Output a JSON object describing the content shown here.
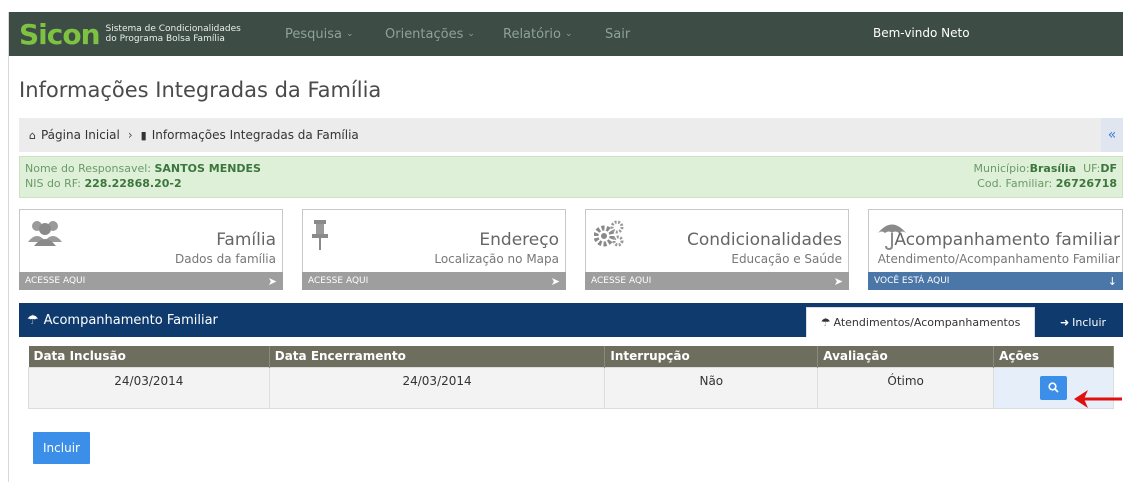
{
  "header": {
    "logo": "Sicon",
    "logo_line1": "Sistema de Condicionalidades",
    "logo_line2": "do Programa Bolsa Família",
    "nav": [
      "Pesquisa",
      "Orientações",
      "Relatório",
      "Sair"
    ],
    "welcome": "Bem-vindo Neto"
  },
  "page_title": "Informações Integradas da Família",
  "breadcrumb": {
    "home": "Página Inicial",
    "current": "Informações Integradas da Família",
    "collapse": "«"
  },
  "responsavel": {
    "nome_label": "Nome do Responsavel:",
    "nome": "SANTOS MENDES",
    "nis_label": "NIS do RF:",
    "nis": "228.22868.20-2",
    "municipio_label": "Município:",
    "municipio": "Brasília",
    "uf_label": "UF:",
    "uf": "DF",
    "cod_label": "Cod. Familiar:",
    "cod": "26726718"
  },
  "cards": [
    {
      "title": "Família",
      "subtitle": "Dados da família",
      "footer": "ACESSE AQUI",
      "icon": "users-icon"
    },
    {
      "title": "Endereço",
      "subtitle": "Localização no Mapa",
      "footer": "ACESSE AQUI",
      "icon": "pin-icon"
    },
    {
      "title": "Condicionalidades",
      "subtitle": "Educação e Saúde",
      "footer": "ACESSE AQUI",
      "icon": "gears-icon"
    },
    {
      "title": "Acompanhamento familiar",
      "subtitle": "Atendimento/Acompanhamento Familiar",
      "footer": "VOCÊ ESTÁ AQUI",
      "icon": "umbrella-icon"
    }
  ],
  "panel": {
    "title": "Acompanhamento Familiar",
    "tab_active": "Atendimentos/Acompanhamentos",
    "tab_incluir": "Incluir"
  },
  "table": {
    "headers": [
      "Data Inclusão",
      "Data Encerramento",
      "Interrupção",
      "Avaliação",
      "Ações"
    ],
    "rows": [
      {
        "inclusao": "24/03/2014",
        "encerramento": "24/03/2014",
        "interrupcao": "Não",
        "avaliacao": "Ótimo"
      }
    ]
  },
  "incluir_button": "Incluir",
  "colors": {
    "topbar": "#3d4c45",
    "logo_accent": "#7ec242",
    "panel_header": "#0e3a6e",
    "primary_button": "#3b8fe8",
    "active_card_footer": "#4b76a8",
    "annotation_arrow": "#e01010"
  }
}
